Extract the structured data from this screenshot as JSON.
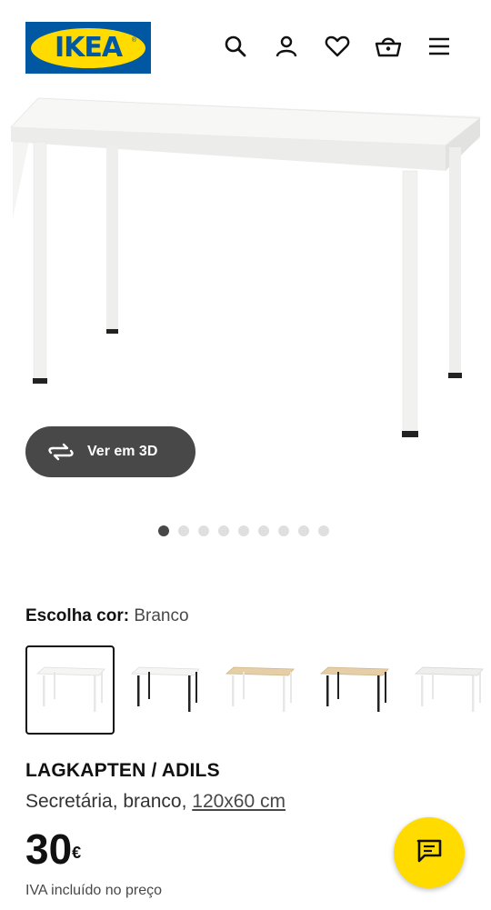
{
  "header": {
    "logo_text": "IKEA",
    "icons": [
      "search-icon",
      "account-icon",
      "heart-icon",
      "basket-icon",
      "menu-icon"
    ]
  },
  "gallery": {
    "view3d_label": "Ver em 3D",
    "dot_count": 9,
    "active_dot": 1
  },
  "color": {
    "label": "Escolha cor:",
    "value": "Branco"
  },
  "product": {
    "name": "LAGKAPTEN / ADILS",
    "desc_prefix": "Secretária, branco, ",
    "dimensions": "120x60 cm",
    "price": "30",
    "currency": "€",
    "vat_note": "IVA incluído no preço"
  },
  "colors": {
    "brand_blue": "#0058a3",
    "brand_yellow": "#ffdb00",
    "dark": "#484848"
  }
}
